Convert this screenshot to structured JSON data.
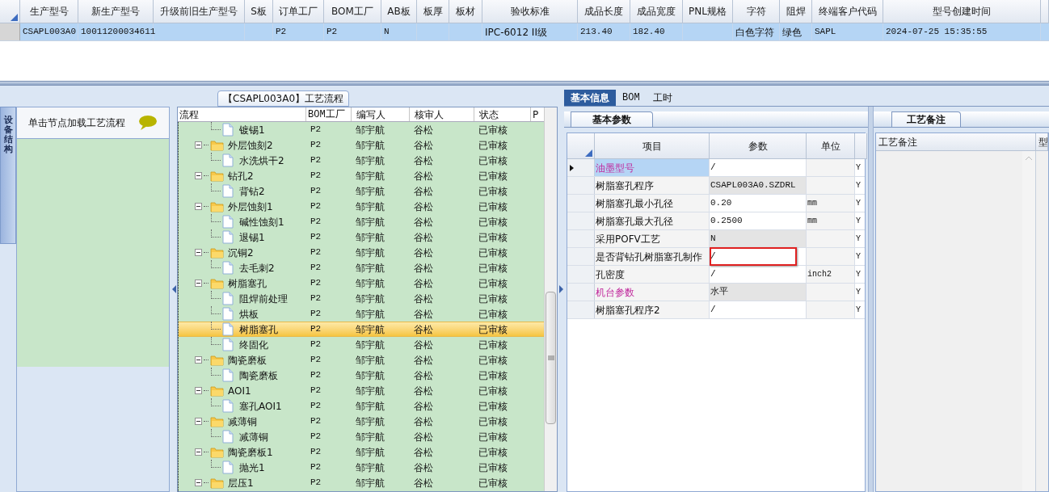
{
  "top_grid": {
    "columns": [
      "生产型号",
      "新生产型号",
      "升级前旧生产型号",
      "S板",
      "订单工厂",
      "BOM工厂",
      "AB板",
      "板厚",
      "板材",
      "验收标准",
      "成品长度",
      "成品宽度",
      "PNL规格",
      "字符",
      "阻焊",
      "终端客户代码",
      "型号创建时间"
    ],
    "rows": [
      {
        "selected": true,
        "cells": [
          "CSAPL003A0",
          "10011200034611",
          null,
          null,
          "P2",
          "P2",
          "N",
          null,
          null,
          "IPC-6012 II级",
          "213.40",
          "182.40",
          null,
          "白色字符",
          "绿色",
          "SAPL",
          "2024-07-25 15:35:55"
        ]
      }
    ]
  },
  "left_panel": {
    "side_tab": "设备结构",
    "hint": "单击节点加载工艺流程"
  },
  "flow_panel": {
    "title": "【CSAPL003A0】工艺流程",
    "columns": [
      "流程",
      "BOM工厂",
      "编写人",
      "核审人",
      "状态",
      "P"
    ],
    "rows": [
      {
        "label": "镀锡1",
        "kind": "step",
        "bom": "P2",
        "writer": "邹宇航",
        "reviewer": "谷松",
        "status": "已审核",
        "selected": false
      },
      {
        "label": "外层蚀刻2",
        "kind": "folder",
        "bom": "P2",
        "writer": "邹宇航",
        "reviewer": "谷松",
        "status": "已审核",
        "selected": false,
        "expanded": true,
        "children": [
          {
            "label": "水洗烘干2",
            "kind": "step",
            "bom": "P2",
            "writer": "邹宇航",
            "reviewer": "谷松",
            "status": "已审核",
            "selected": false
          }
        ]
      },
      {
        "label": "钻孔2",
        "kind": "folder",
        "bom": "P2",
        "writer": "邹宇航",
        "reviewer": "谷松",
        "status": "已审核",
        "selected": false,
        "expanded": true,
        "children": [
          {
            "label": "背钻2",
            "kind": "step",
            "bom": "P2",
            "writer": "邹宇航",
            "reviewer": "谷松",
            "status": "已审核",
            "selected": false
          }
        ]
      },
      {
        "label": "外层蚀刻1",
        "kind": "folder",
        "bom": "P2",
        "writer": "邹宇航",
        "reviewer": "谷松",
        "status": "已审核",
        "selected": false,
        "expanded": true,
        "children": [
          {
            "label": "碱性蚀刻1",
            "kind": "step",
            "bom": "P2",
            "writer": "邹宇航",
            "reviewer": "谷松",
            "status": "已审核",
            "selected": false
          },
          {
            "label": "退锡1",
            "kind": "step",
            "bom": "P2",
            "writer": "邹宇航",
            "reviewer": "谷松",
            "status": "已审核",
            "selected": false
          }
        ]
      },
      {
        "label": "沉铜2",
        "kind": "folder",
        "bom": "P2",
        "writer": "邹宇航",
        "reviewer": "谷松",
        "status": "已审核",
        "selected": false,
        "expanded": true,
        "children": [
          {
            "label": "去毛刺2",
            "kind": "step",
            "bom": "P2",
            "writer": "邹宇航",
            "reviewer": "谷松",
            "status": "已审核",
            "selected": false
          }
        ]
      },
      {
        "label": "树脂塞孔",
        "kind": "folder",
        "bom": "P2",
        "writer": "邹宇航",
        "reviewer": "谷松",
        "status": "已审核",
        "selected": false,
        "expanded": true,
        "children": [
          {
            "label": "阻焊前处理",
            "kind": "step",
            "bom": "P2",
            "writer": "邹宇航",
            "reviewer": "谷松",
            "status": "已审核",
            "selected": false
          },
          {
            "label": "烘板",
            "kind": "step",
            "bom": "P2",
            "writer": "邹宇航",
            "reviewer": "谷松",
            "status": "已审核",
            "selected": false
          },
          {
            "label": "树脂塞孔",
            "kind": "step",
            "bom": "P2",
            "writer": "邹宇航",
            "reviewer": "谷松",
            "status": "已审核",
            "selected": true
          },
          {
            "label": "终固化",
            "kind": "step",
            "bom": "P2",
            "writer": "邹宇航",
            "reviewer": "谷松",
            "status": "已审核",
            "selected": false
          }
        ]
      },
      {
        "label": "陶瓷磨板",
        "kind": "folder",
        "bom": "P2",
        "writer": "邹宇航",
        "reviewer": "谷松",
        "status": "已审核",
        "selected": false,
        "expanded": true,
        "children": [
          {
            "label": "陶瓷磨板",
            "kind": "step",
            "bom": "P2",
            "writer": "邹宇航",
            "reviewer": "谷松",
            "status": "已审核",
            "selected": false
          }
        ]
      },
      {
        "label": "AOI1",
        "kind": "folder",
        "bom": "P2",
        "writer": "邹宇航",
        "reviewer": "谷松",
        "status": "已审核",
        "selected": false,
        "expanded": true,
        "children": [
          {
            "label": "塞孔AOI1",
            "kind": "step",
            "bom": "P2",
            "writer": "邹宇航",
            "reviewer": "谷松",
            "status": "已审核",
            "selected": false
          }
        ]
      },
      {
        "label": "减薄铜",
        "kind": "folder",
        "bom": "P2",
        "writer": "邹宇航",
        "reviewer": "谷松",
        "status": "已审核",
        "selected": false,
        "expanded": true,
        "children": [
          {
            "label": "减薄铜",
            "kind": "step",
            "bom": "P2",
            "writer": "邹宇航",
            "reviewer": "谷松",
            "status": "已审核",
            "selected": false
          }
        ]
      },
      {
        "label": "陶瓷磨板1",
        "kind": "folder",
        "bom": "P2",
        "writer": "邹宇航",
        "reviewer": "谷松",
        "status": "已审核",
        "selected": false,
        "expanded": true,
        "children": [
          {
            "label": "抛光1",
            "kind": "step",
            "bom": "P2",
            "writer": "邹宇航",
            "reviewer": "谷松",
            "status": "已审核",
            "selected": false
          }
        ]
      },
      {
        "label": "层压1",
        "kind": "folder",
        "bom": "P2",
        "writer": "邹宇航",
        "reviewer": "谷松",
        "status": "已审核",
        "selected": false,
        "expanded": true
      }
    ]
  },
  "detail_tabs": [
    {
      "label": "基本信息",
      "selected": true
    },
    {
      "label": "BOM",
      "selected": false
    },
    {
      "label": "工时",
      "selected": false
    }
  ],
  "params_tab": "基本参数",
  "params_grid": {
    "columns": [
      "项目",
      "参数",
      "单位"
    ],
    "rows": [
      {
        "item": "油墨型号",
        "kind": "section",
        "value": "/",
        "flag": "Y",
        "selected": true,
        "editable": true,
        "marked": false
      },
      {
        "item": "树脂塞孔程序",
        "kind": "param",
        "value": "CSAPL003A0.SZDRL",
        "flag": "Y",
        "selected": false,
        "editable": false,
        "marked": false
      },
      {
        "item": "树脂塞孔最小孔径",
        "kind": "param",
        "value": "0.20",
        "unit": "mm",
        "flag": "Y",
        "selected": false,
        "editable": true,
        "marked": false
      },
      {
        "item": "树脂塞孔最大孔径",
        "kind": "param",
        "value": "0.2500",
        "unit": "mm",
        "flag": "Y",
        "selected": false,
        "editable": true,
        "marked": false
      },
      {
        "item": "采用POFV工艺",
        "kind": "param",
        "value": "N",
        "flag": "Y",
        "selected": false,
        "editable": false,
        "marked": false
      },
      {
        "item": "是否背钻孔树脂塞孔制作",
        "kind": "param",
        "value": "/",
        "flag": "Y",
        "selected": false,
        "editable": true,
        "marked": true
      },
      {
        "item": "孔密度",
        "kind": "param",
        "value": "/",
        "unit": "inch2",
        "flag": "Y",
        "selected": false,
        "editable": true,
        "marked": false
      },
      {
        "item": "机台参数",
        "kind": "section",
        "value": "水平",
        "flag": "Y",
        "selected": false,
        "editable": false,
        "marked": false
      },
      {
        "item": "树脂塞孔程序2",
        "kind": "param",
        "value": "/",
        "flag": "Y",
        "selected": false,
        "editable": true,
        "marked": false
      }
    ]
  },
  "notes_panel": {
    "tab": "工艺备注",
    "columns": [
      "工艺备注",
      "型"
    ]
  }
}
